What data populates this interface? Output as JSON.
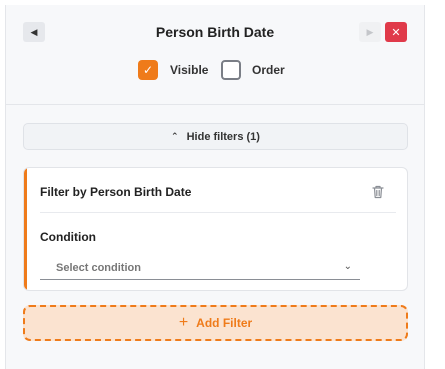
{
  "header": {
    "title": "Person Birth Date"
  },
  "options": {
    "visible_label": "Visible",
    "visible_checked": true,
    "order_label": "Order",
    "order_checked": false
  },
  "filters_toggle": {
    "label": "Hide filters (1)"
  },
  "filter_card": {
    "title": "Filter by Person Birth Date",
    "condition_label": "Condition",
    "condition_placeholder": "Select condition"
  },
  "add_filter": {
    "label": "Add Filter"
  },
  "colors": {
    "accent": "#ef7b1a",
    "close": "#e03a4a"
  },
  "icons": {
    "back": "caret-left-icon",
    "next": "caret-right-icon",
    "close": "close-icon",
    "check": "check-icon",
    "collapse": "chevron-up-icon",
    "delete": "trash-icon",
    "dropdown": "chevron-down-icon",
    "add": "plus-icon"
  }
}
